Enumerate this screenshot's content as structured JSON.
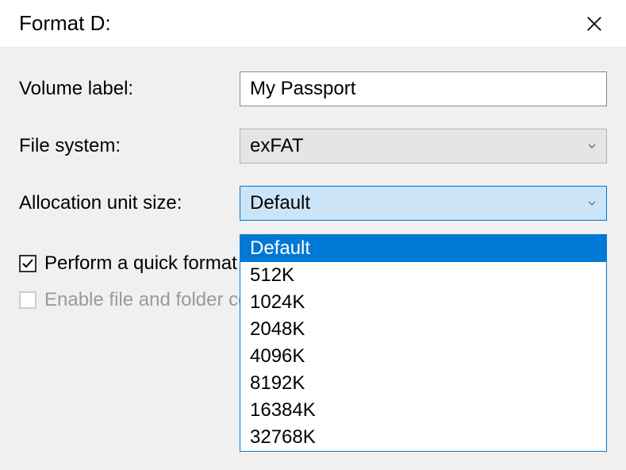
{
  "window": {
    "title": "Format D:"
  },
  "fields": {
    "volume_label": {
      "label": "Volume label:",
      "value": "My Passport"
    },
    "file_system": {
      "label": "File system:",
      "value": "exFAT"
    },
    "allocation_unit": {
      "label": "Allocation unit size:",
      "value": "Default",
      "options": [
        "Default",
        "512K",
        "1024K",
        "2048K",
        "4096K",
        "8192K",
        "16384K",
        "32768K"
      ]
    }
  },
  "checkboxes": {
    "quick_format": {
      "label": "Perform a quick format",
      "checked": true,
      "enabled": true
    },
    "enable_compression": {
      "label": "Enable file and folder compression",
      "checked": false,
      "enabled": false
    }
  }
}
